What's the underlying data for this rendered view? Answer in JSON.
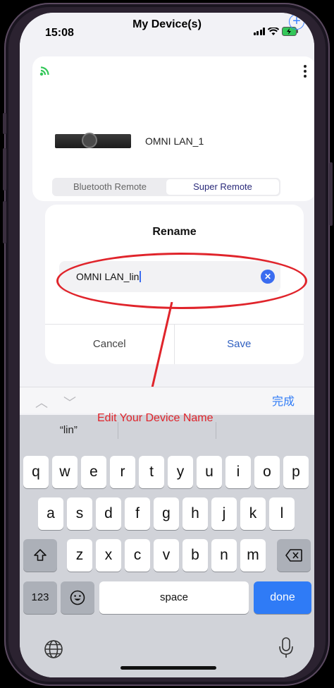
{
  "status_bar": {
    "time": "15:08",
    "title": "My Device(s)"
  },
  "device_card": {
    "device_name": "OMNI LAN_1",
    "tabs": [
      {
        "label": "Bluetooth Remote",
        "active": false
      },
      {
        "label": "Super Remote",
        "active": true
      }
    ]
  },
  "rename_dialog": {
    "title": "Rename",
    "input_value": "OMNI LAN_lin",
    "cancel_label": "Cancel",
    "save_label": "Save"
  },
  "annotation": {
    "label": "Edit Your Device Name",
    "color": "#e0242b"
  },
  "keyboard": {
    "accessory_done": "完成",
    "suggestion": "“lin”",
    "row1": [
      "q",
      "w",
      "e",
      "r",
      "t",
      "y",
      "u",
      "i",
      "o",
      "p"
    ],
    "row2": [
      "a",
      "s",
      "d",
      "f",
      "g",
      "h",
      "j",
      "k",
      "l"
    ],
    "row3": [
      "z",
      "x",
      "c",
      "v",
      "b",
      "n",
      "m"
    ],
    "numbers_label": "123",
    "space_label": "space",
    "done_label": "done"
  },
  "colors": {
    "accent": "#2f7bf6",
    "wifi": "#34c759"
  }
}
